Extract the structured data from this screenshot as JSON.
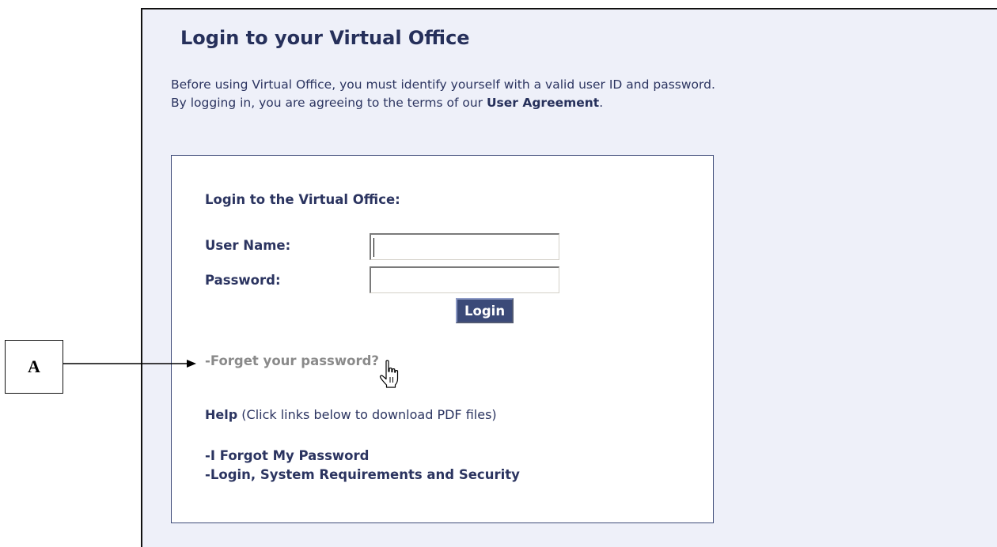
{
  "page": {
    "title": "Login to your Virtual Office",
    "intro_line1": "Before using Virtual Office, you must identify yourself with a valid user ID and password.",
    "intro_line2_prefix": "By logging in, you are agreeing to the terms of our ",
    "intro_line2_link": "User Agreement",
    "intro_line2_suffix": "."
  },
  "login_box": {
    "heading": "Login to the Virtual Office:",
    "username_label": "User Name:",
    "username_value": "",
    "password_label": "Password:",
    "password_value": "",
    "login_button": "Login",
    "forgot_link": "-Forget your password?",
    "help_label": "Help",
    "help_text": " (Click links below to download PDF files)",
    "pdf_links": [
      "-I Forgot My Password",
      "-Login, System Requirements and Security"
    ]
  },
  "annotation": {
    "callout_label": "A"
  },
  "icons": {
    "cursor": "hand-pointer-icon",
    "arrow": "arrow-right-icon"
  },
  "colors": {
    "panel_background": "#eef0f9",
    "heading_text": "#26305b",
    "button_background": "#3b4a78",
    "forgot_link_text": "#8a8a8a"
  }
}
